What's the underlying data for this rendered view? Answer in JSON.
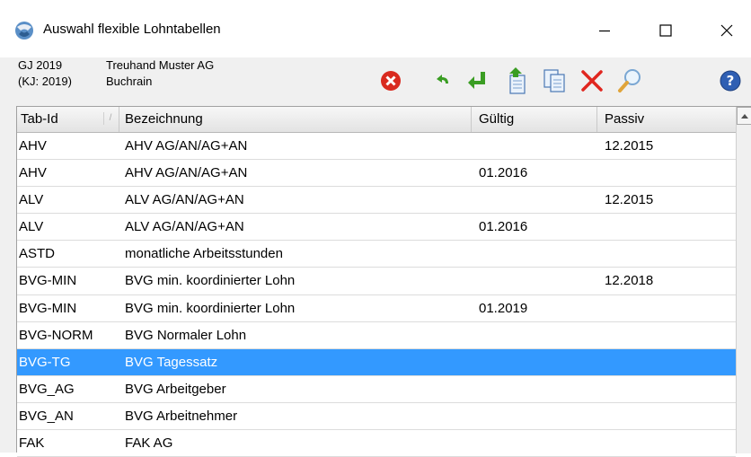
{
  "window": {
    "title": "Auswahl flexible Lohntabellen"
  },
  "info": {
    "gj": "GJ 2019",
    "kj": "(KJ: 2019)",
    "company": "Treuhand Muster AG",
    "location": "Buchrain"
  },
  "toolbar": {
    "icons": [
      "close-red-icon",
      "undo-arrow-icon",
      "enter-arrow-icon",
      "export-icon",
      "copy-icon",
      "delete-icon",
      "search-icon",
      "help-icon"
    ]
  },
  "table": {
    "headers": [
      "Tab-Id",
      "Bezeichnung",
      "Gültig",
      "Passiv"
    ],
    "sort_indicator": "/",
    "selected_row": 8,
    "rows": [
      [
        "AHV",
        "AHV AG/AN/AG+AN",
        "",
        "12.2015"
      ],
      [
        "AHV",
        "AHV AG/AN/AG+AN",
        "01.2016",
        ""
      ],
      [
        "ALV",
        "ALV AG/AN/AG+AN",
        "",
        "12.2015"
      ],
      [
        "ALV",
        "ALV AG/AN/AG+AN",
        "01.2016",
        ""
      ],
      [
        "ASTD",
        "monatliche Arbeitsstunden",
        "",
        ""
      ],
      [
        "BVG-MIN",
        "BVG min. koordinierter Lohn",
        "",
        "12.2018"
      ],
      [
        "BVG-MIN",
        "BVG min. koordinierter Lohn",
        "01.2019",
        ""
      ],
      [
        "BVG-NORM",
        "BVG Normaler Lohn",
        "",
        ""
      ],
      [
        "BVG-TG",
        "BVG Tagessatz",
        "",
        ""
      ],
      [
        "BVG_AG",
        "BVG Arbeitgeber",
        "",
        ""
      ],
      [
        "BVG_AN",
        "BVG Arbeitnehmer",
        "",
        ""
      ],
      [
        "FAK",
        "FAK AG",
        "",
        ""
      ]
    ]
  },
  "colors": {
    "selection": "#3399ff",
    "delete_red": "#e0261f",
    "enter_green": "#3a9d23"
  }
}
